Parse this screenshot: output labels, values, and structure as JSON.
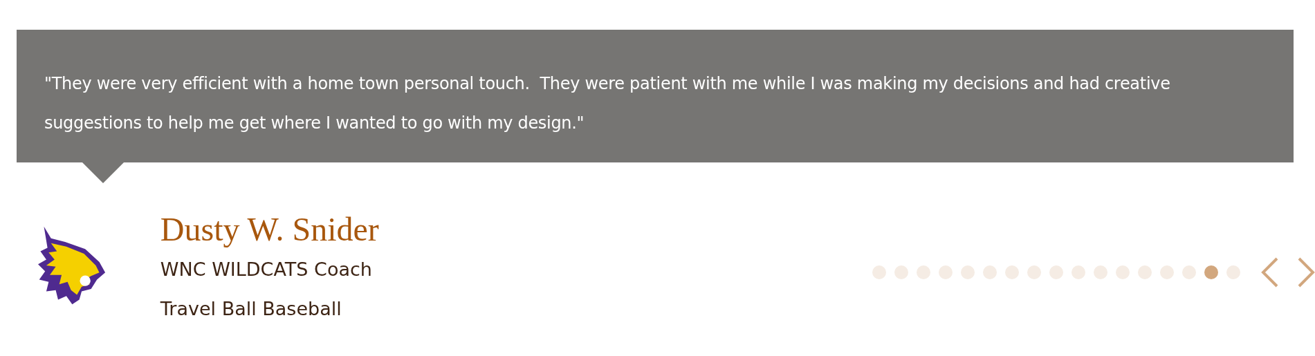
{
  "testimonial": {
    "quote": "\"They were very efficient with a home town personal touch.  They were patient with me while I was making my decisions and had creative suggestions to help me get where I wanted to go with my design.\"",
    "name": "Dusty W. Snider",
    "role": "WNC WILDCATS Coach",
    "organization": "Travel Ball Baseball"
  },
  "pager": [
    {
      "selected": false
    },
    {
      "selected": false
    },
    {
      "selected": false
    },
    {
      "selected": false
    },
    {
      "selected": false
    },
    {
      "selected": false
    },
    {
      "selected": false
    },
    {
      "selected": false
    },
    {
      "selected": false
    },
    {
      "selected": false
    },
    {
      "selected": false
    },
    {
      "selected": false
    },
    {
      "selected": false
    },
    {
      "selected": false
    },
    {
      "selected": false
    },
    {
      "selected": true
    },
    {
      "selected": false
    }
  ]
}
